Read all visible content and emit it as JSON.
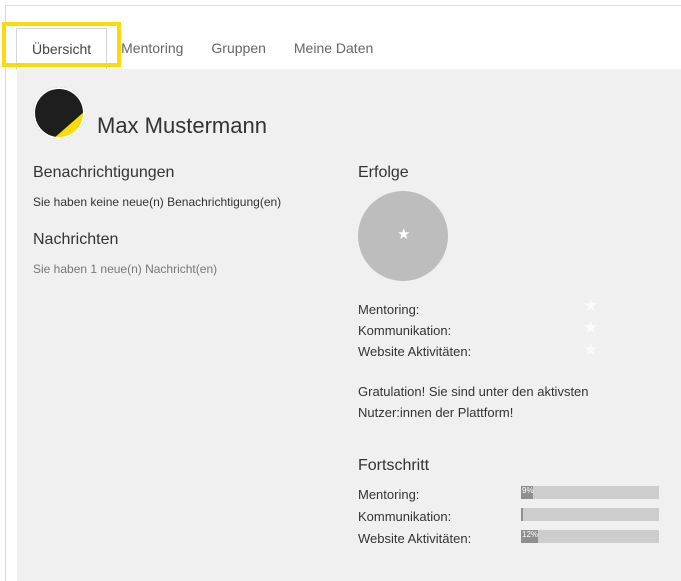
{
  "tabs": [
    {
      "label": "Übersicht",
      "active": true
    },
    {
      "label": "Mentoring",
      "active": false
    },
    {
      "label": "Gruppen",
      "active": false
    },
    {
      "label": "Meine Daten",
      "active": false
    }
  ],
  "profile": {
    "name": "Max Mustermann",
    "avatar_icon": "user-avatar-icon"
  },
  "notifications": {
    "title": "Benachrichtigungen",
    "text": "Sie haben keine neue(n) Benachrichtigung(en)"
  },
  "messages": {
    "title": "Nachrichten",
    "text": "Sie haben 1 neue(n) Nachricht(en)"
  },
  "achievements": {
    "title": "Erfolge",
    "badge_icon": "star-icon",
    "items": [
      {
        "label": "Mentoring:",
        "icon": "star-icon"
      },
      {
        "label": "Kommunikation:",
        "icon": "star-icon"
      },
      {
        "label": "Website Aktivitäten:",
        "icon": "star-icon"
      }
    ],
    "congrats_line1": "Gratulation! Sie sind unter den aktivsten",
    "congrats_line2": "Nutzer:innen der Plattform!"
  },
  "progress": {
    "title": "Fortschritt",
    "items": [
      {
        "label": "Mentoring:",
        "value": "9%",
        "percent": 9
      },
      {
        "label": "Kommunikation:",
        "value": "",
        "percent": 0
      },
      {
        "label": "Website Aktivitäten:",
        "value": "12%",
        "percent": 12
      }
    ]
  },
  "colors": {
    "highlight": "#fadb0a",
    "panel_bg": "#f0f0f0",
    "progress_fill": "#8f8f8f",
    "progress_track": "#cdcdcd",
    "badge_bg": "#bdbdbd"
  }
}
